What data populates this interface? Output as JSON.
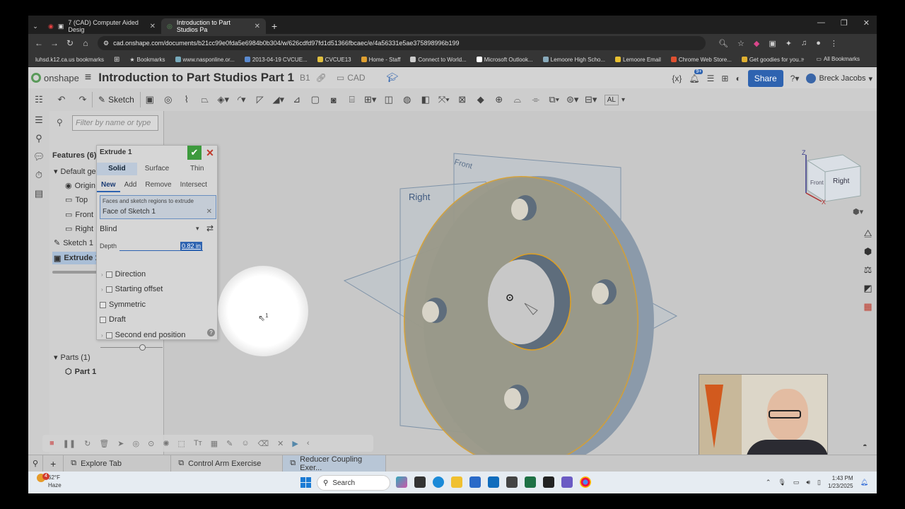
{
  "browser": {
    "tabs": [
      {
        "label": "7 (CAD) Computer Aided Desig",
        "active": false
      },
      {
        "label": "Introduction to Part Studios Pa",
        "active": true
      }
    ],
    "url": "cad.onshape.com/documents/b21cc99e0fda5e6984b0b304/w/626cdfd97fd1d51366fbcaec/e/4a56331e5ae375898996b199",
    "bookmarks": [
      "luhsd.k12.ca.us bookmarks",
      "Bookmarks",
      "www.nasponline.or...",
      "2013-04-19 CVCUE...",
      "CVCUE13",
      "Home - Staff",
      "Connect to World...",
      "Microsoft Outlook...",
      "Lemoore High Scho...",
      "Lemoore Email",
      "Chrome Web Store...",
      "Get goodies for you..."
    ],
    "all_bookmarks": "All Bookmarks"
  },
  "app": {
    "logo": "onshape",
    "doc_title": "Introduction to Part Studios Part 1",
    "branch": "B1",
    "folder": "CAD",
    "notifications": "9+",
    "share_label": "Share",
    "user_name": "Breck Jacobs"
  },
  "toolbar": {
    "sketch_label": "Sketch",
    "view_label": "AL"
  },
  "tree": {
    "filter_placeholder": "Filter by name or type",
    "features_header": "Features (6)",
    "default_geometry": "Default ge",
    "items": [
      "Origin",
      "Top",
      "Front",
      "Right"
    ],
    "sketch": "Sketch 1",
    "extrude": "Extrude 1",
    "parts_header": "Parts (1)",
    "part": "Part 1"
  },
  "dialog": {
    "title": "Extrude 1",
    "body_tabs": [
      "Solid",
      "Surface",
      "Thin"
    ],
    "op_tabs": [
      "New",
      "Add",
      "Remove",
      "Intersect"
    ],
    "faces_label": "Faces and sketch regions to extrude",
    "faces_value": "Face of Sketch 1",
    "end_type": "Blind",
    "depth_label": "Depth",
    "depth_value": "0.82 in",
    "options": [
      "Direction",
      "Starting offset",
      "Symmetric",
      "Draft",
      "Second end position"
    ]
  },
  "viewport": {
    "plane_labels": [
      "Front",
      "Right"
    ],
    "cube_labels": {
      "z": "Z",
      "x": "X",
      "front": "Front",
      "right": "Right"
    },
    "cursor_badge": "1"
  },
  "bottom_tabs": [
    "Explore Tab",
    "Control Arm Exercise",
    "Reducer Coupling Exer..."
  ],
  "taskbar": {
    "weather_temp": "62°F",
    "weather_desc": "Haze",
    "weather_alert": "4",
    "search_label": "Search",
    "time": "1:43 PM",
    "date": "1/23/2025"
  },
  "colors": {
    "accent": "#2e63b0",
    "ok_green": "#3d9a3d",
    "part_edge": "#e0a020",
    "part_fill": "#8e9fb0"
  }
}
